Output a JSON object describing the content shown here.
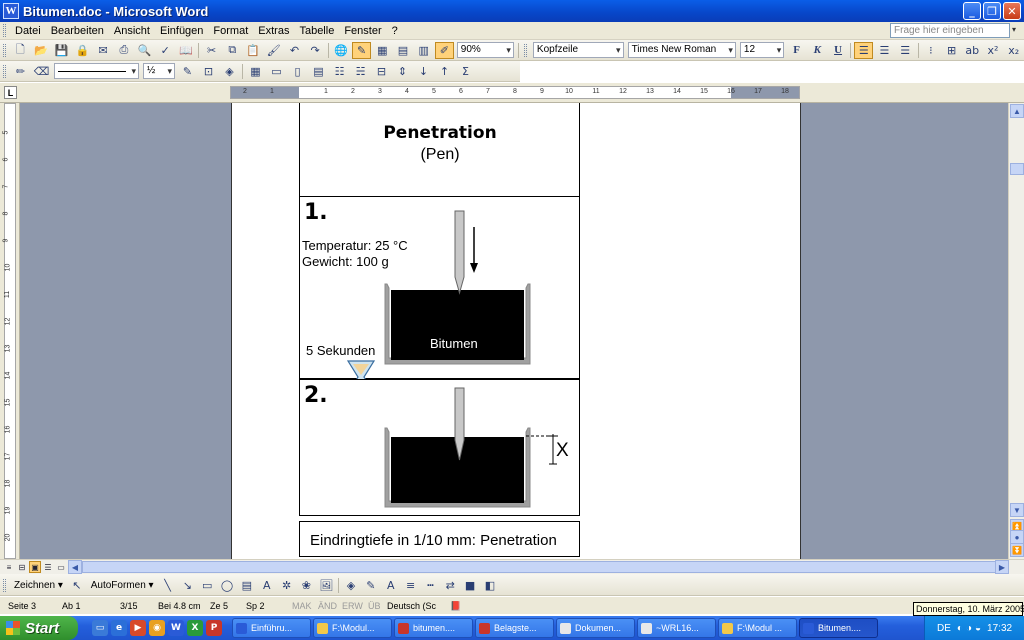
{
  "window": {
    "title": "Bitumen.doc - Microsoft Word",
    "app_icon": "W"
  },
  "menu": {
    "items": [
      "Datei",
      "Bearbeiten",
      "Ansicht",
      "Einfügen",
      "Format",
      "Extras",
      "Tabelle",
      "Fenster",
      "?"
    ],
    "ask_placeholder": "Frage hier eingeben"
  },
  "toolbar": {
    "zoom": "90%",
    "style": "Kopfzeile",
    "font": "Times New Roman",
    "size": "12",
    "bold": "F",
    "italic": "K",
    "underline": "U",
    "line_weight": "½"
  },
  "document": {
    "title": "Penetration",
    "subtitle": "(Pen)",
    "step1_label": "1.",
    "temperature": "Temperatur: 25 °C",
    "weight": "Gewicht: 100 g",
    "material_label": "Bitumen",
    "time_label": "5 Sekunden",
    "step2_label": "2.",
    "depth_symbol": "X",
    "result_text": "Eindringtiefe in 1/10 mm: Penetration"
  },
  "drawing_toolbar": {
    "draw_menu": "Zeichnen",
    "autoshapes_menu": "AutoFormen"
  },
  "status": {
    "page": "Seite 3",
    "section": "Ab 1",
    "pages": "3/15",
    "position": "Bei 4.8 cm",
    "line": "Ze 5",
    "column": "Sp 2",
    "rec": "MAK",
    "trk": "ÄND",
    "ext": "ERW",
    "ovr": "ÜB",
    "language": "Deutsch (Sc"
  },
  "tooltip": "Donnerstag, 10. März 2005",
  "taskbar": {
    "start_label": "Start",
    "tasks": [
      {
        "label": "Einführu...",
        "icon": "word-icon"
      },
      {
        "label": "F:\\Modul...",
        "icon": "folder-icon"
      },
      {
        "label": "bitumen....",
        "icon": "pdf-icon"
      },
      {
        "label": "Belagste...",
        "icon": "pdf-icon"
      },
      {
        "label": "Dokumen...",
        "icon": "window-icon"
      },
      {
        "label": "~WRL16...",
        "icon": "window-icon"
      },
      {
        "label": "F:\\Modul ...",
        "icon": "folder-icon"
      },
      {
        "label": "Bitumen....",
        "icon": "word-icon"
      }
    ],
    "tray_lang": "DE",
    "clock": "17:32"
  },
  "colors": {
    "title_blue": "#0846c8",
    "taskbar_blue": "#245fdc",
    "start_green": "#3a9e36",
    "doc_gray": "#8e98ac"
  }
}
